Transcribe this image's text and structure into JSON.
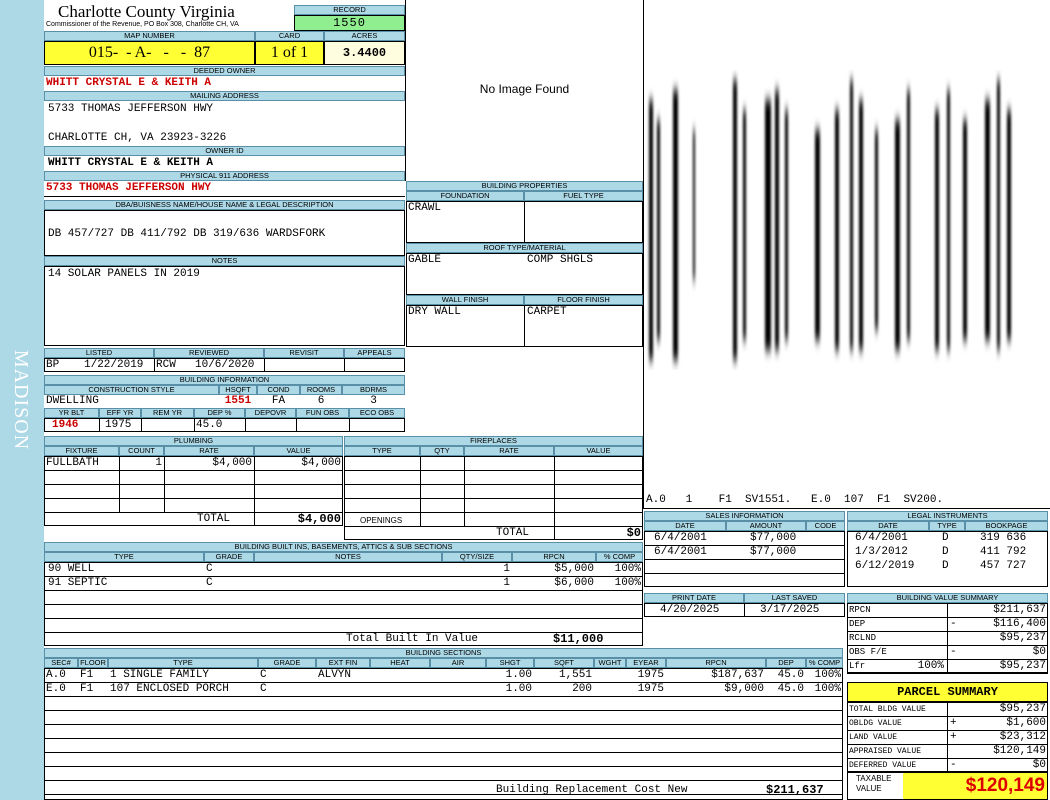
{
  "county": "Charlotte County Virginia",
  "commissioner": "Commissioner of the Revenue, PO Box 308, Charlotte CH, VA",
  "district": "MADISON",
  "labels": {
    "record": "RECORD",
    "map_number": "MAP NUMBER",
    "card": "CARD",
    "acres": "ACRES",
    "deeded_owner": "DEEDED OWNER",
    "mailing_address": "MAILING ADDRESS",
    "owner_id": "OWNER ID",
    "physical_address": "PHYSICAL 911 ADDRESS",
    "dba": "DBA/BUISNESS NAME/HOUSE NAME & LEGAL DESCRIPTION",
    "notes": "NOTES",
    "listed": "LISTED",
    "reviewed": "REVIEWED",
    "revisit": "REVISIT",
    "appeals": "APPEALS",
    "building_information": "BUILDING INFORMATION",
    "construction_style": "CONSTRUCTION STYLE",
    "hsqft": "HSQFT",
    "cond": "COND",
    "rooms": "ROOMS",
    "bdrms": "BDRMS",
    "yr_blt": "YR BLT",
    "eff_yr": "EFF YR",
    "rem_yr": "REM YR",
    "dep_pct": "DEP %",
    "depovr": "DEPOVR",
    "fun_obs": "FUN OBS",
    "eco_obs": "ECO OBS",
    "building_properties": "BUILDING PROPERTIES",
    "foundation": "FOUNDATION",
    "fuel_type": "FUEL TYPE",
    "roof": "ROOF TYPE/MATERIAL",
    "wall_finish": "WALL FINISH",
    "floor_finish": "FLOOR FINISH",
    "no_image": "No Image Found",
    "plumbing": "PLUMBING",
    "fixture": "FIXTURE",
    "count": "COUNT",
    "rate": "RATE",
    "value": "VALUE",
    "total": "TOTAL",
    "fireplaces": "FIREPLACES",
    "type": "TYPE",
    "qty": "QTY",
    "openings": "OPENINGS",
    "sales_information": "SALES INFORMATION",
    "date": "DATE",
    "amount": "AMOUNT",
    "code": "CODE",
    "legal_instruments": "LEGAL INSTRUMENTS",
    "bookpage": "BOOKPAGE",
    "print_date": "PRINT DATE",
    "last_saved": "LAST SAVED",
    "built_ins": "BUILDING BUILT INS, BASEMENTS, ATTICS & SUB SECTIONS",
    "grade": "GRADE",
    "notes_col": "NOTES",
    "qty_size": "QTY/SIZE",
    "rpcn": "RPCN",
    "pct_comp": "% COMP",
    "total_built_in": "Total Built In Value",
    "building_sections": "BUILDING SECTIONS",
    "bvs": "BUILDING VALUE SUMMARY",
    "parcel_summary": "PARCEL SUMMARY",
    "taxable_value": "TAXABLE\nVALUE",
    "brcn": "Building Replacement Cost New"
  },
  "record": "1550",
  "map_number": "015-  - A-   -   -  87",
  "card": "1 of 1",
  "acres": "3.4400",
  "deeded_owner": "WHITT CRYSTAL E & KEITH A",
  "mailing_line1": "5733 THOMAS JEFFERSON HWY",
  "mailing_line2": "CHARLOTTE CH, VA 23923-3226",
  "owner_id": "WHITT CRYSTAL E & KEITH A",
  "physical_address": "5733 THOMAS JEFFERSON HWY",
  "dba": "DB 457/727 DB 411/792 DB 319/636 WARDSFORK",
  "notes": "14 SOLAR PANELS IN 2019",
  "listed_code": "BP",
  "listed_date": "1/22/2019",
  "reviewed_code": "RCW",
  "reviewed_date": "10/6/2020",
  "construction_style": "DWELLING",
  "hsqft": "1551",
  "cond": "FA",
  "rooms": "6",
  "bdrms": "3",
  "yr_blt": "1946",
  "eff_yr": "1975",
  "dep_pct": "45.0",
  "foundation": "CRAWL",
  "roof_type": "GABLE",
  "roof_material": "COMP SHGLS",
  "wall_finish": "DRY WALL",
  "floor_finish": "CARPET",
  "sketch_caption": "A.0   1    F1  SV1551.   E.0  107  F1  SV200.",
  "plumbing": [
    {
      "fixture": "FULLBATH",
      "count": "1",
      "rate": "$4,000",
      "value": "$4,000"
    }
  ],
  "plumbing_total": "$4,000",
  "fireplace_total": "$0",
  "sales": [
    {
      "date": "6/4/2001",
      "amount": "$77,000",
      "code": ""
    },
    {
      "date": "6/4/2001",
      "amount": "$77,000",
      "code": ""
    }
  ],
  "legal": [
    {
      "date": "6/4/2001",
      "type": "D",
      "bookpage": "319 636"
    },
    {
      "date": "1/3/2012",
      "type": "D",
      "bookpage": "411 792"
    },
    {
      "date": "6/12/2019",
      "type": "D",
      "bookpage": "457 727"
    }
  ],
  "print_date": "4/20/2025",
  "last_saved": "3/17/2025",
  "built_ins": [
    {
      "type": "90 WELL",
      "grade": "C",
      "qty": "1",
      "rpcn": "$5,000",
      "comp": "100%"
    },
    {
      "type": "91 SEPTIC",
      "grade": "C",
      "qty": "1",
      "rpcn": "$6,000",
      "comp": "100%"
    }
  ],
  "total_built_in_value": "$11,000",
  "section_cols": [
    "SEC#",
    "FLOOR",
    "TYPE",
    "GRADE",
    "EXT FIN",
    "HEAT",
    "AIR",
    "SHGT",
    "SQFT",
    "WGHT",
    "EYEAR",
    "RPCN",
    "DEP",
    "% COMP"
  ],
  "sections": [
    {
      "sec": "A.0",
      "floor": "F1",
      "type": "1 SINGLE FAMILY",
      "grade": "C",
      "ext_fin": "ALVYN",
      "heat": "",
      "air": "",
      "shgt": "1.00",
      "sqft": "1,551",
      "wght": "",
      "eyear": "1975",
      "rpcn": "$187,637",
      "dep": "45.0",
      "comp": "100%"
    },
    {
      "sec": "E.0",
      "floor": "F1",
      "type": "107 ENCLOSED PORCH",
      "grade": "C",
      "ext_fin": "",
      "heat": "",
      "air": "",
      "shgt": "1.00",
      "sqft": "200",
      "wght": "",
      "eyear": "1975",
      "rpcn": "$9,000",
      "dep": "45.0",
      "comp": "100%"
    }
  ],
  "brcn_value": "$211,637",
  "bvs": [
    {
      "label": "RPCN",
      "sign": "",
      "value": "$211,637"
    },
    {
      "label": "DEP",
      "sign": "-",
      "value": "$116,400"
    },
    {
      "label": "RCLND",
      "sign": "",
      "value": "$95,237"
    },
    {
      "label": "OBS F/E",
      "sign": "-",
      "value": "$0"
    },
    {
      "label": "Lfr",
      "pct": "100%",
      "sign": "",
      "value": "$95,237"
    }
  ],
  "parcel": [
    {
      "label": "TOTAL BLDG VALUE",
      "sign": "",
      "value": "$95,237"
    },
    {
      "label": "OBLDG VALUE",
      "sign": "+",
      "value": "$1,600"
    },
    {
      "label": "LAND VALUE",
      "sign": "+",
      "value": "$23,312"
    },
    {
      "label": "APPRAISED VALUE",
      "sign": "",
      "value": "$120,149"
    },
    {
      "label": "DEFERRED VALUE",
      "sign": "-",
      "value": "$0"
    }
  ],
  "taxable_value": "$120,149"
}
